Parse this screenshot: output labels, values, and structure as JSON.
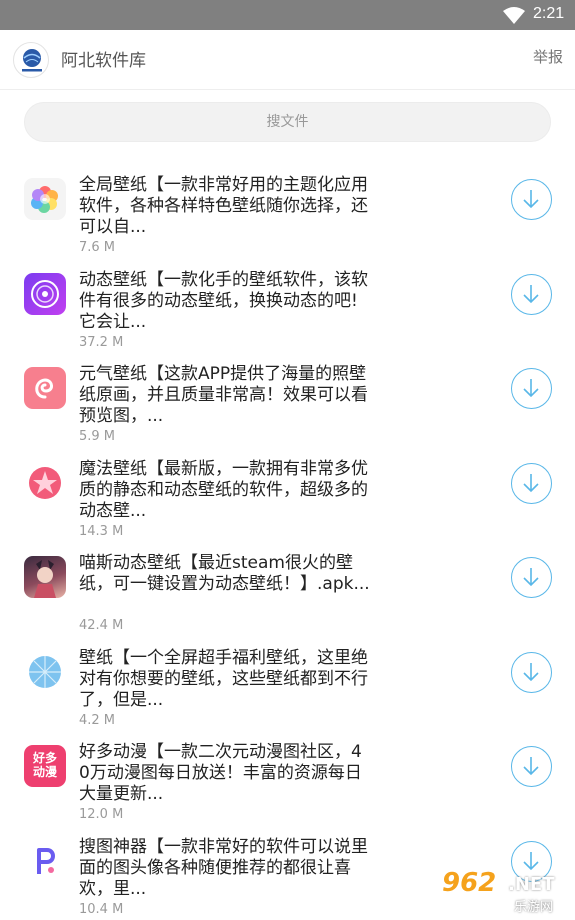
{
  "status_bar": {
    "time": "2:21"
  },
  "app_bar": {
    "title": "阿北软件库",
    "report_label": "举报"
  },
  "search": {
    "placeholder": "搜文件"
  },
  "items": [
    {
      "text": "全局壁纸【一款非常好用的主题化应用软件，各种各样特色壁纸随你选择，还可以自...",
      "size": "7.6 M",
      "icon": "flower-icon"
    },
    {
      "text": "动态壁纸【一款化手的壁纸软件，该软件有很多的动态壁纸，换换动态的吧!它会让...",
      "size": "37.2 M",
      "icon": "disc-icon"
    },
    {
      "text": "元气壁纸【这款APP提供了海量的照壁纸原画，并且质量非常高！效果可以看预览图，...",
      "size": "5.9 M",
      "icon": "swirl-icon"
    },
    {
      "text": "魔法壁纸【最新版，一款拥有非常多优质的静态和动态壁纸的软件，超级多的动态壁...",
      "size": "14.3 M",
      "icon": "magic-star-icon"
    },
    {
      "text": "喵斯动态壁纸【最近steam很火的壁纸，可一键设置为动态壁纸！】.apk...",
      "size": "42.4 M",
      "icon": "anime-character-icon"
    },
    {
      "text": "壁纸【一个全屏超手福利壁纸，这里绝对有你想要的壁纸，这些壁纸都到不行了，但是...",
      "size": "4.2 M",
      "icon": "umbrella-icon"
    },
    {
      "text": "好多动漫【一款二次元动漫图社区，40万动漫图每日放送！丰富的资源每日大量更新...",
      "size": "12.0 M",
      "icon": "haoduo-dongman-icon",
      "icon_text_1": "好多",
      "icon_text_2": "动漫"
    },
    {
      "text": "搜图神器【一款非常好的软件可以说里面的图头像各种随便推荐的都很让喜欢，里...",
      "size": "10.4 M",
      "icon": "p-letter-icon"
    }
  ],
  "watermark": {
    "number": "962",
    "suffix": ".NET",
    "label": "乐游网"
  },
  "colors": {
    "accent": "#59b7e8",
    "status_bar": "#808080"
  }
}
